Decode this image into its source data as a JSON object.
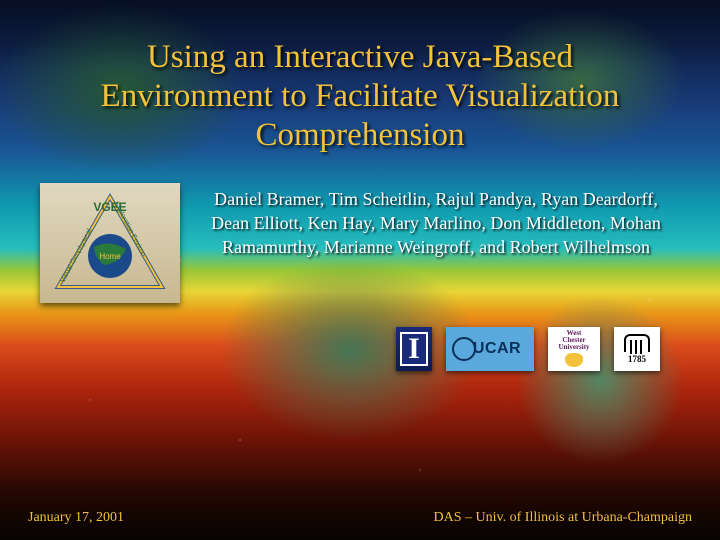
{
  "title": "Using an Interactive Java-Based Environment to Facilitate Visualization Comprehension",
  "authors": "Daniel Bramer, Tim Scheitlin, Rajul Pandya, Ryan Deardorff, Dean Elliott, Ken Hay, Mary Marlino, Don Middleton, Mohan Ramamurthy, Marianne Weingroff, and Robert Wilhelmson",
  "vgee": {
    "label_top": "VGEE",
    "label_left": "Visual Geophysical",
    "label_right": "Exploration Environ",
    "label_center": "Home"
  },
  "logos": {
    "illinois_letter": "I",
    "ucar": "UCAR",
    "wcu_line1": "West",
    "wcu_line2": "Chester",
    "wcu_line3": "University",
    "uga_year": "1785"
  },
  "footer": {
    "date": "January 17, 2001",
    "affiliation": "DAS – Univ. of Illinois at Urbana-Champaign"
  }
}
